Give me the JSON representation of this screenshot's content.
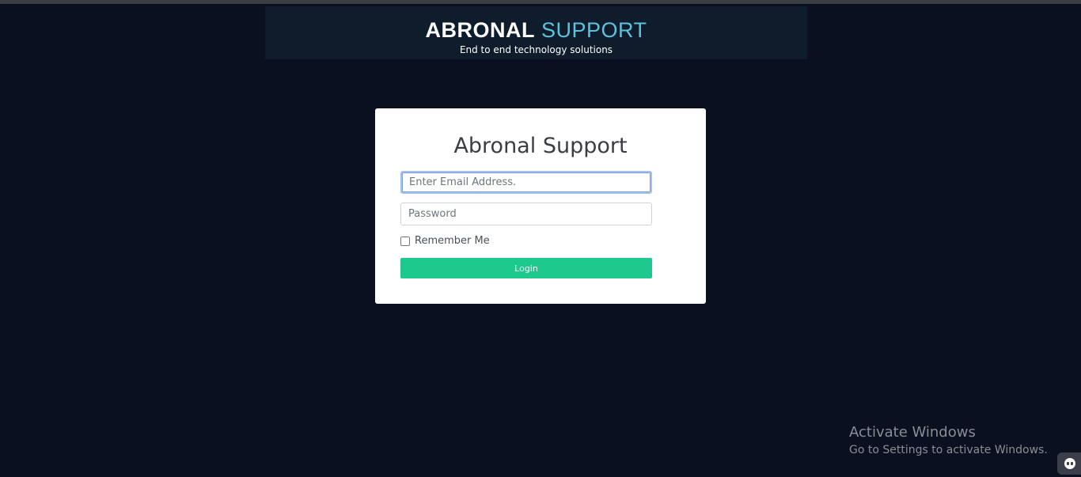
{
  "banner": {
    "logo_word_1": "ABRONAL",
    "logo_word_2": "SUPPORT",
    "tagline": "End to end technology solutions"
  },
  "login_card": {
    "title": "Abronal Support",
    "email_placeholder": "Enter Email Address.",
    "password_placeholder": "Password",
    "remember_label": "Remember Me",
    "login_label": "Login"
  },
  "watermark": {
    "title": "Activate Windows",
    "subtitle": "Go to Settings to activate Windows."
  },
  "icons": {
    "corner_badge": "chat-bot-icon"
  },
  "colors": {
    "background": "#0a1020",
    "banner": "#0e1c2b",
    "accent": "#5bc2e0",
    "login_button": "#1dc98c"
  }
}
